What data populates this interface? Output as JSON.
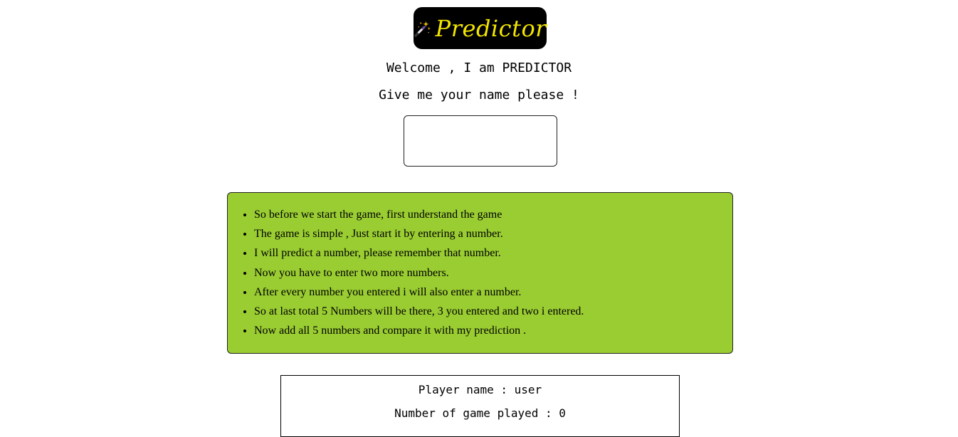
{
  "logo": {
    "icon": "magic-wand-icon",
    "text": "Predictor",
    "text_color": "#f2e500",
    "background": "#000000"
  },
  "welcome": "Welcome , I am PREDICTOR",
  "prompt": "Give me your name please !",
  "name_input": {
    "value": "",
    "placeholder": ""
  },
  "rules": {
    "background": "#9acd32",
    "items": [
      "So before we start the game, first understand the game",
      "The game is simple , Just start it by entering a number.",
      "I will predict a number, please remember that number.",
      "Now you have to enter two more numbers.",
      "After every number you entered i will also enter a number.",
      "So at last total 5 Numbers will be there, 3 you entered and two i entered.",
      "Now add all 5 numbers and compare it with my prediction ."
    ]
  },
  "stats": {
    "player_label": "Player name : user",
    "games_label": "Number of game played : 0"
  }
}
